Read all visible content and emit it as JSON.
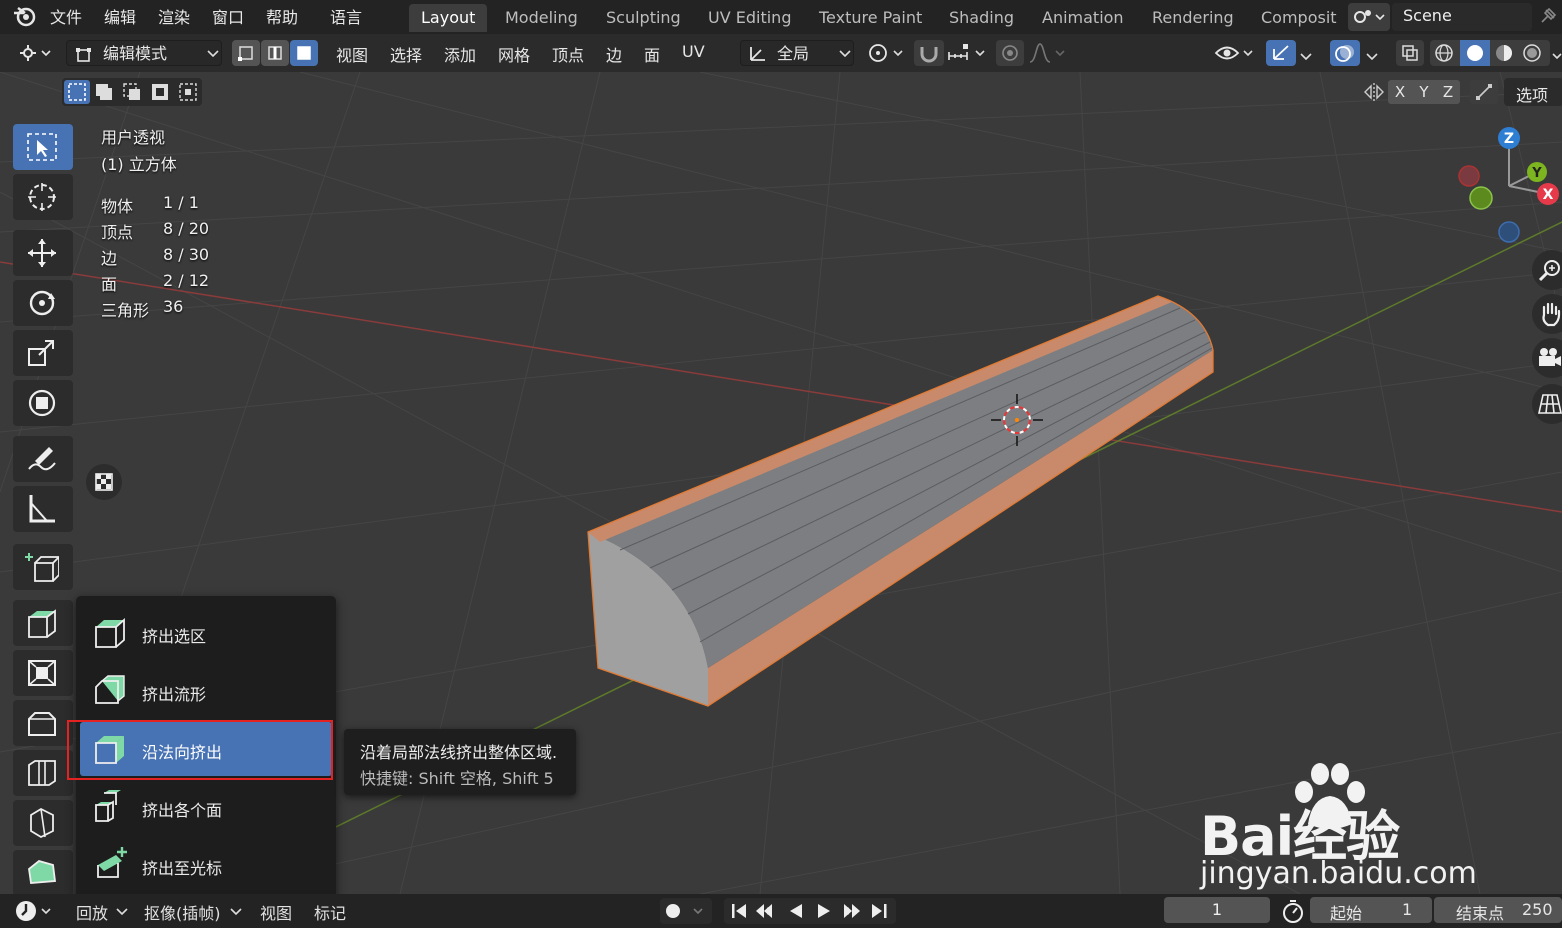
{
  "menu": {
    "file": "文件",
    "edit": "编辑",
    "render": "渲染",
    "window": "窗口",
    "help": "帮助",
    "language": "语言"
  },
  "workspace_tabs": [
    "Layout",
    "Modeling",
    "Sculpting",
    "UV Editing",
    "Texture Paint",
    "Shading",
    "Animation",
    "Rendering",
    "Composit"
  ],
  "scene": {
    "name": "Scene"
  },
  "toolbar": {
    "mode": "编辑模式",
    "menus": [
      "视图",
      "选择",
      "添加",
      "网格",
      "顶点",
      "边",
      "面",
      "UV"
    ],
    "transform_orientation": "全局",
    "axis_x": "X",
    "axis_y": "Y",
    "axis_z": "Z",
    "options": "选项"
  },
  "viewport": {
    "view_name": "用户透视",
    "object_name": "(1) 立方体",
    "stats": [
      {
        "label": "物体",
        "value": "1 / 1"
      },
      {
        "label": "顶点",
        "value": "8 / 20"
      },
      {
        "label": "边",
        "value": "8 / 30"
      },
      {
        "label": "面",
        "value": "2 / 12"
      },
      {
        "label": "三角形",
        "value": "36"
      }
    ],
    "gizmo": {
      "z": "Z",
      "y": "Y",
      "x": "X"
    }
  },
  "flyout": {
    "items": [
      "挤出选区",
      "挤出流形",
      "沿法向挤出",
      "挤出各个面",
      "挤出至光标"
    ],
    "active_index": 2
  },
  "tooltip": {
    "description": "沿着局部法线挤出整体区域.",
    "shortcut": "快捷键: Shift 空格, Shift 5"
  },
  "timeline": {
    "playback": "回放",
    "keying": "抠像(插帧)",
    "view": "视图",
    "marker": "标记",
    "current_frame": "1",
    "start_label": "起始",
    "start_value": "1",
    "end_label": "结束点",
    "end_value": "250"
  },
  "watermark": {
    "brand": "Bai经验",
    "url": "jingyan.baidu.com"
  },
  "colors": {
    "accent": "#4772b3",
    "highlight_border": "#e52222",
    "selected_face": "#c88a6a"
  }
}
